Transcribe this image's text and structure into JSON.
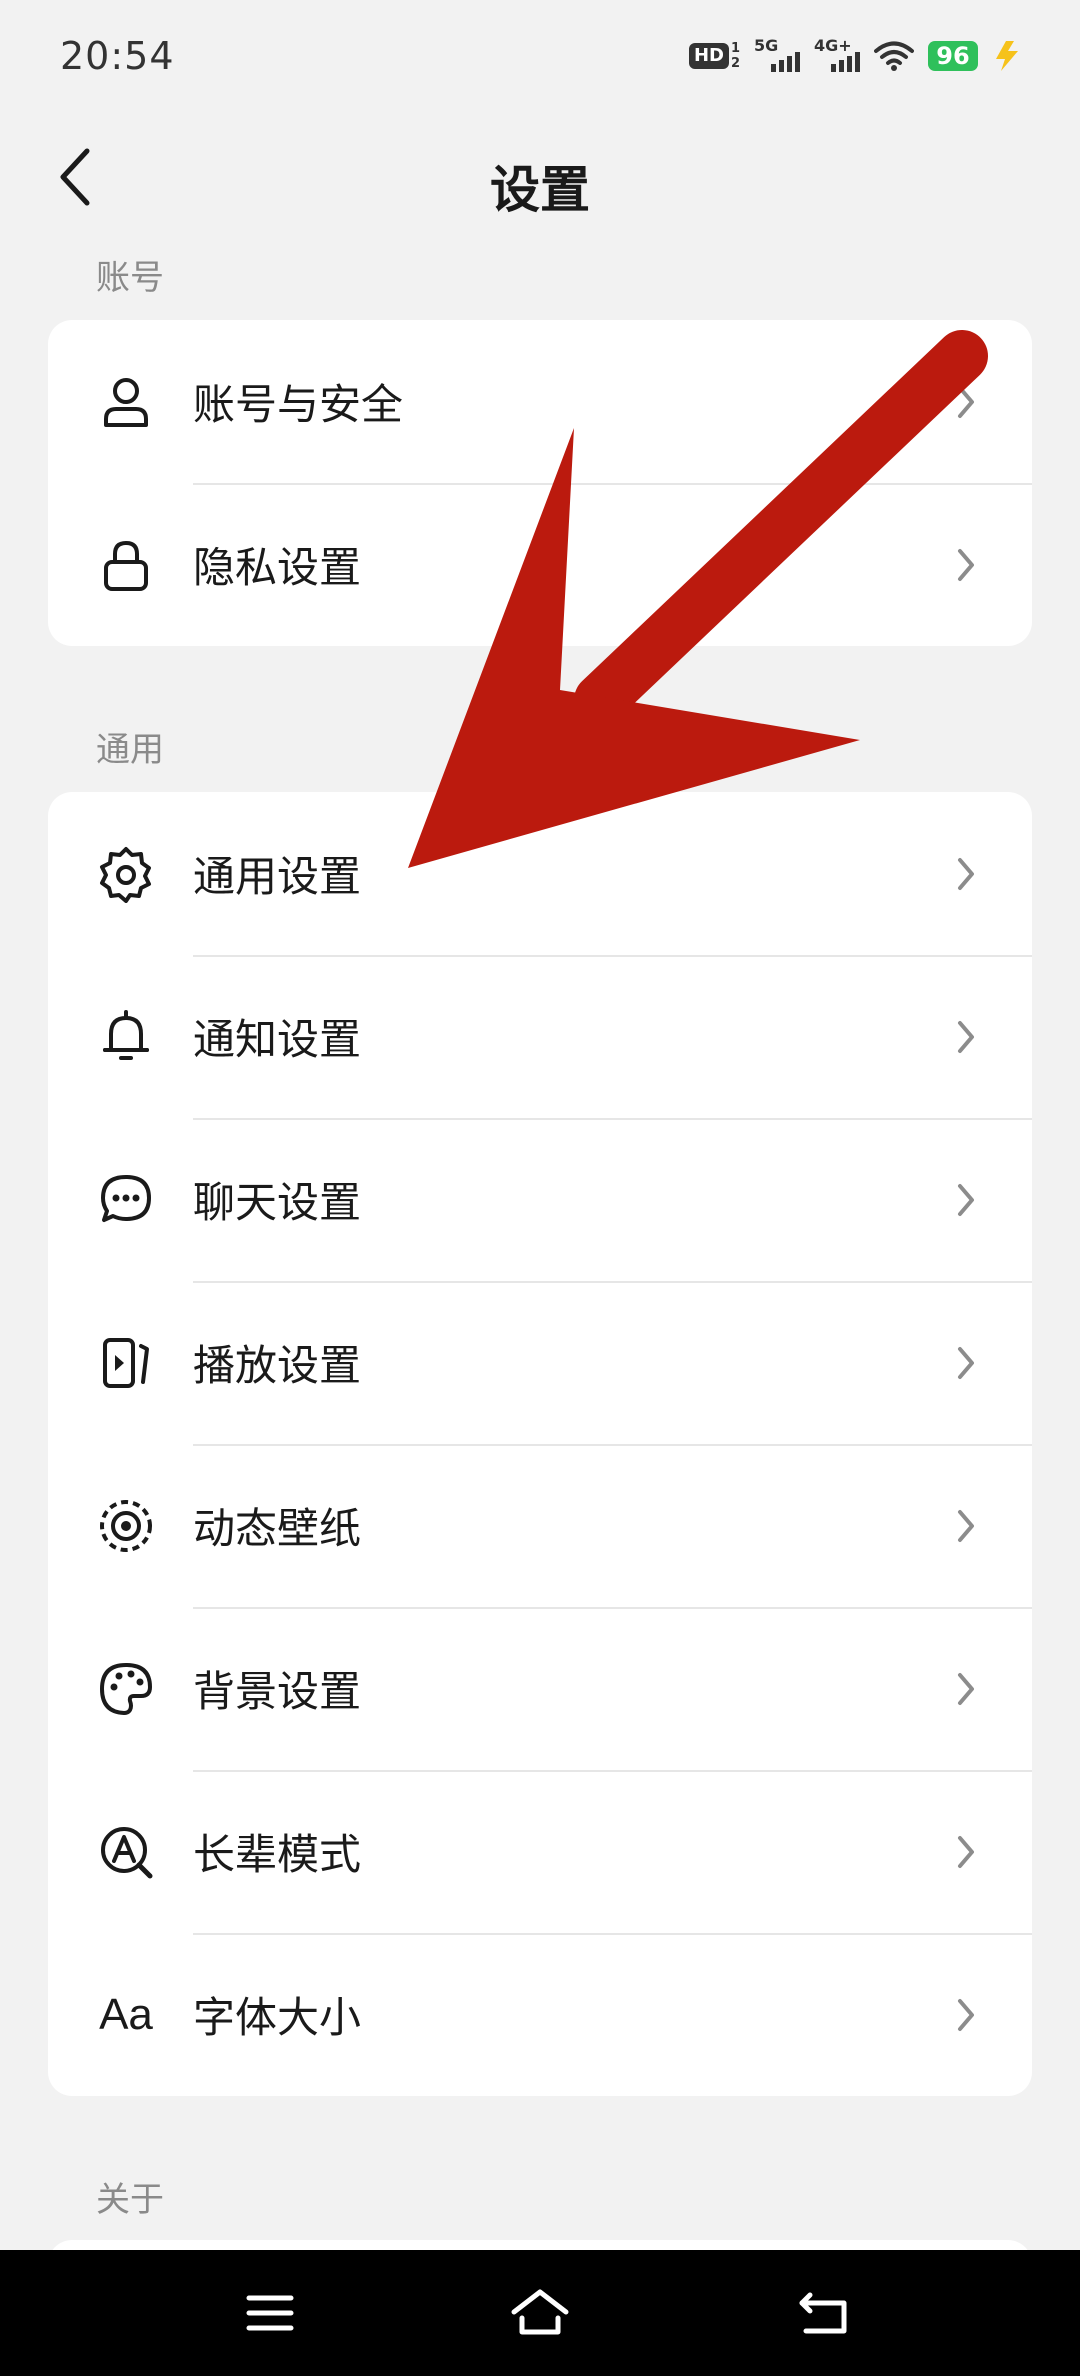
{
  "status_bar": {
    "time": "20:54",
    "hd_label": "HD",
    "hd_sub_top": "1",
    "hd_sub_bottom": "2",
    "signal1_label": "5G",
    "signal2_label": "4G+",
    "battery": "96",
    "battery_color": "#2fc05b"
  },
  "header": {
    "title": "设置"
  },
  "sections": {
    "account": {
      "label": "账号",
      "items": [
        {
          "label": "账号与安全",
          "icon": "user-icon"
        },
        {
          "label": "隐私设置",
          "icon": "lock-icon"
        }
      ]
    },
    "general": {
      "label": "通用",
      "items": [
        {
          "label": "通用设置",
          "icon": "gear-icon"
        },
        {
          "label": "通知设置",
          "icon": "bell-icon"
        },
        {
          "label": "聊天设置",
          "icon": "chat-bubble-icon"
        },
        {
          "label": "播放设置",
          "icon": "play-panel-icon"
        },
        {
          "label": "动态壁纸",
          "icon": "live-wallpaper-icon"
        },
        {
          "label": "背景设置",
          "icon": "palette-icon"
        },
        {
          "label": "长辈模式",
          "icon": "elder-mode-icon"
        },
        {
          "label": "字体大小",
          "icon": "font-size-icon",
          "icon_text": "Aa"
        }
      ]
    },
    "about": {
      "label": "关于"
    }
  },
  "overlay": {
    "arrow_color": "#bb1a0e"
  },
  "nav_bar": {
    "icons": [
      "menu-icon",
      "home-icon",
      "back-icon"
    ]
  }
}
